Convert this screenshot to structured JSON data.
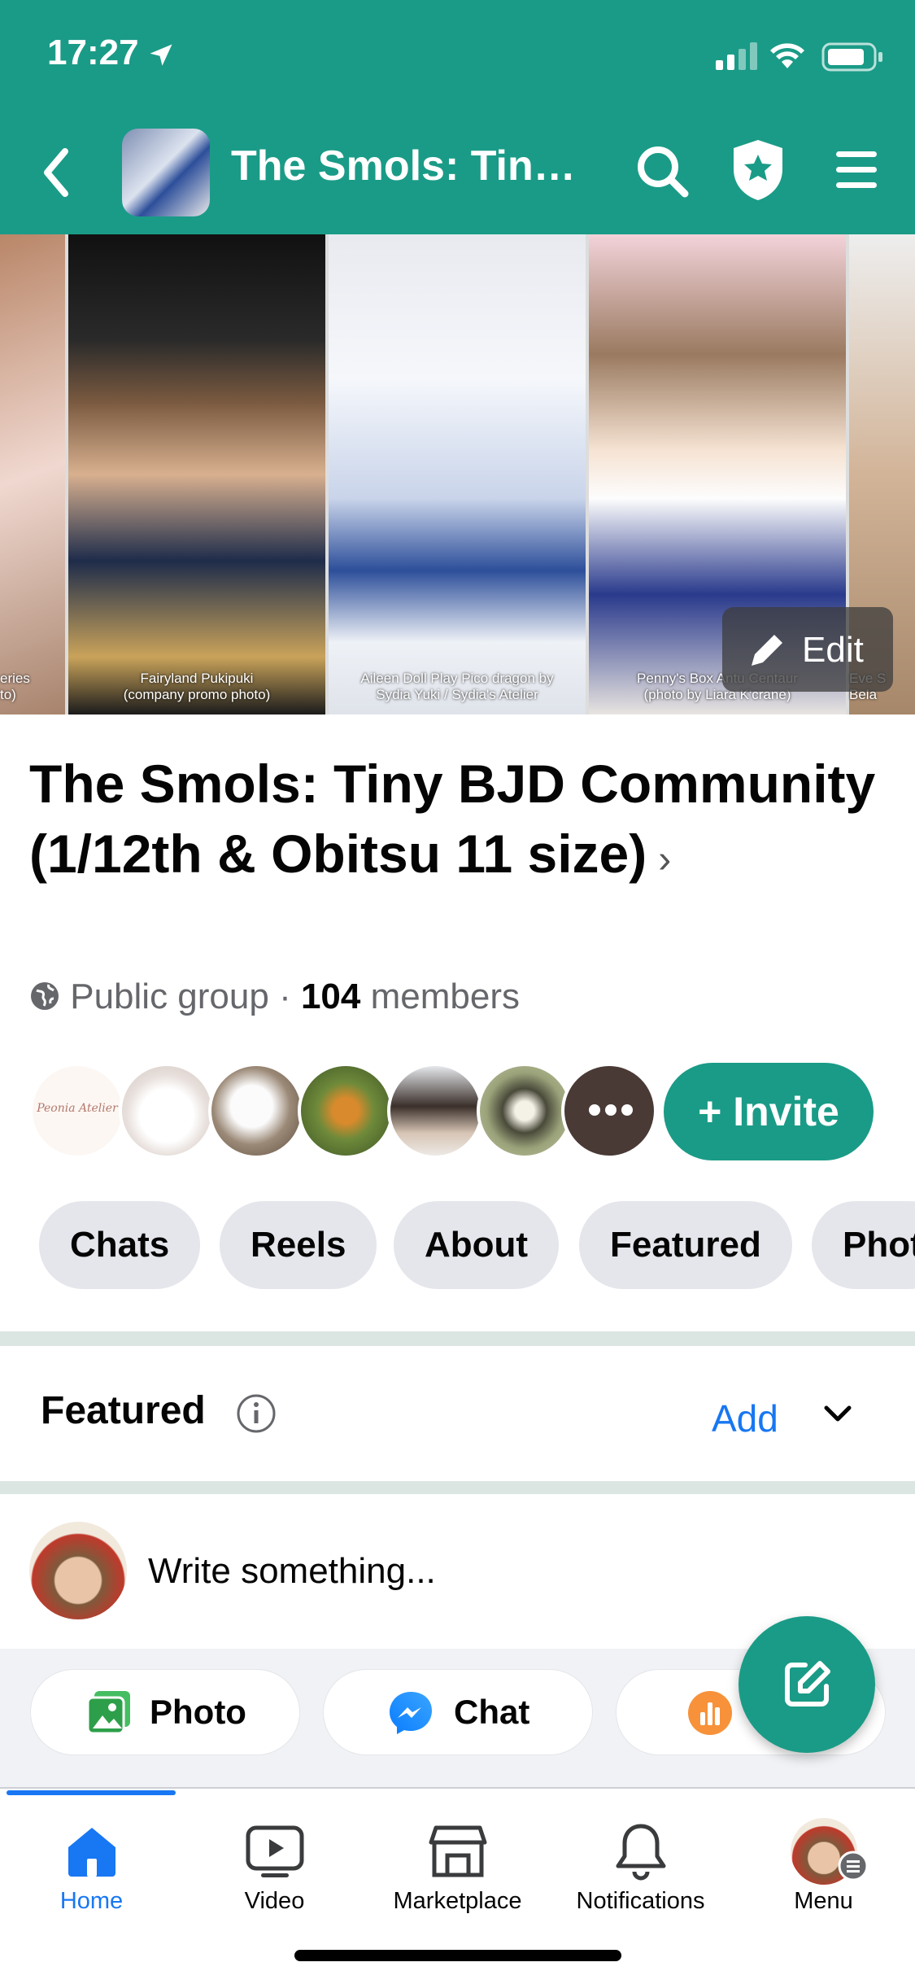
{
  "status_bar": {
    "time": "17:27"
  },
  "header": {
    "title": "The Smols: Tiny…"
  },
  "cover": {
    "captions": [
      "eries\nto)",
      "Fairyland Pukipuki\n(company promo photo)",
      "Aileen Doll Play Pico dragon by\nSydia Yuki / Sydia's Atelier",
      "Penny's Box Antu Centaur\n(photo by Liara K'crane)",
      "Eve S\nBela"
    ],
    "edit_label": "Edit"
  },
  "group": {
    "name": "The Smols: Tiny BJD Community (1/12th & Obitsu 11 size)",
    "privacy": "Public group",
    "member_count": "104",
    "members_label": "members",
    "invite_label": "+ Invite",
    "avatar_logo_text": "Peonia Atelier"
  },
  "tabs": [
    "Chats",
    "Reels",
    "About",
    "Featured",
    "Phot"
  ],
  "featured": {
    "title": "Featured",
    "add_label": "Add"
  },
  "composer": {
    "placeholder": "Write something...",
    "actions": {
      "photo": "Photo",
      "chat": "Chat"
    }
  },
  "bottom_nav": {
    "home": "Home",
    "video": "Video",
    "marketplace": "Marketplace",
    "notifications": "Notifications",
    "menu": "Menu"
  },
  "colors": {
    "accent": "#1a9b87",
    "link": "#1877f2"
  }
}
